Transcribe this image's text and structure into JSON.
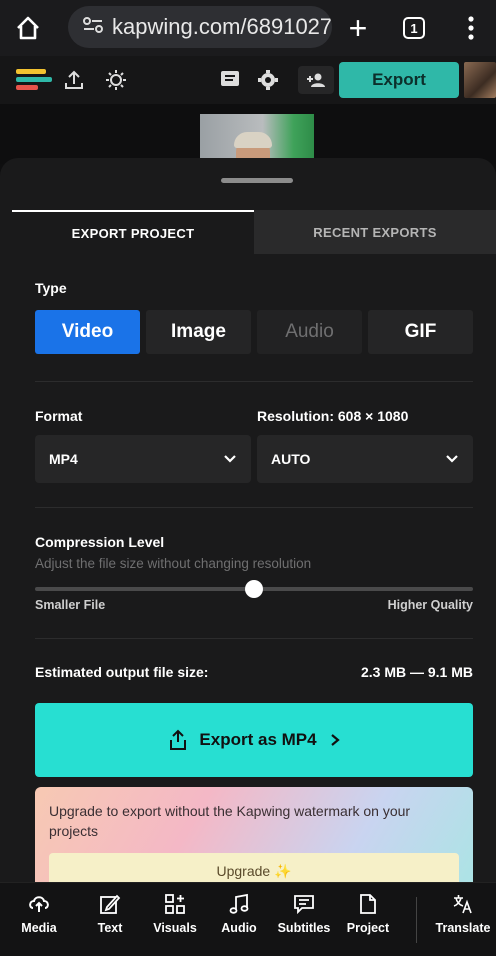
{
  "browser": {
    "url": "kapwing.com/6891027",
    "tab_count": "1"
  },
  "toolbar": {
    "export_label": "Export"
  },
  "sheet": {
    "tabs": [
      {
        "label": "EXPORT PROJECT",
        "active": true
      },
      {
        "label": "RECENT EXPORTS",
        "active": false
      }
    ],
    "type_label": "Type",
    "types": [
      {
        "label": "Video",
        "selected": true
      },
      {
        "label": "Image",
        "selected": false
      },
      {
        "label": "Audio",
        "selected": false,
        "disabled": true
      },
      {
        "label": "GIF",
        "selected": false
      }
    ],
    "format_label": "Format",
    "format_value": "MP4",
    "resolution_label": "Resolution:",
    "resolution_value": "608 × 1080",
    "resolution_select": "AUTO",
    "compression_title": "Compression Level",
    "compression_subtitle": "Adjust the file size without changing resolution",
    "compression_level": 0.5,
    "slider_min_label": "Smaller File",
    "slider_max_label": "Higher Quality",
    "estimated_label": "Estimated output file size:",
    "estimated_value": "2.3 MB — 9.1 MB",
    "export_button": "Export as MP4",
    "upgrade_text": "Upgrade to export without the Kapwing watermark on your projects",
    "upgrade_button": "Upgrade ✨"
  },
  "bottom_nav": [
    {
      "label": "Media",
      "icon": "media-icon"
    },
    {
      "label": "Text",
      "icon": "text-edit-icon"
    },
    {
      "label": "Visuals",
      "icon": "visuals-icon"
    },
    {
      "label": "Audio",
      "icon": "music-note-icon"
    },
    {
      "label": "Subtitles",
      "icon": "subtitles-icon"
    },
    {
      "label": "Project",
      "icon": "project-file-icon"
    },
    {
      "label": "Translate",
      "icon": "translate-icon"
    }
  ],
  "colors": {
    "accent": "#27dfd2",
    "selected_type": "#1a73e8",
    "export_top": "#2fb8a8"
  }
}
